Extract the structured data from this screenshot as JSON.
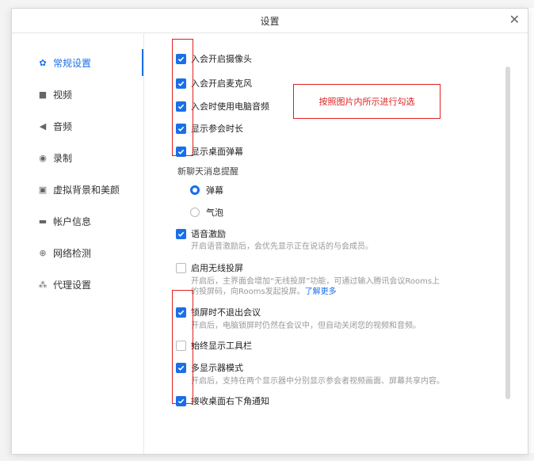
{
  "dialog": {
    "title": "设置"
  },
  "sidebar": {
    "items": [
      {
        "label": "常规设置",
        "icon": "gear-icon",
        "active": true
      },
      {
        "label": "视频",
        "icon": "video-icon"
      },
      {
        "label": "音频",
        "icon": "speaker-icon"
      },
      {
        "label": "录制",
        "icon": "record-icon"
      },
      {
        "label": "虚拟背景和美颜",
        "icon": "portrait-icon"
      },
      {
        "label": "帐户信息",
        "icon": "id-card-icon"
      },
      {
        "label": "网络检测",
        "icon": "globe-icon"
      },
      {
        "label": "代理设置",
        "icon": "network-icon"
      }
    ]
  },
  "options": [
    {
      "label": "入会开启摄像头",
      "checked": true
    },
    {
      "label": "入会开启麦克风",
      "checked": true
    },
    {
      "label": "入会时使用电脑音频",
      "checked": true
    },
    {
      "label": "显示参会时长",
      "checked": true
    },
    {
      "label": "显示桌面弹幕",
      "checked": true
    }
  ],
  "chat_alert": {
    "label": "新聊天消息提醒",
    "options": [
      {
        "label": "弹幕",
        "selected": true
      },
      {
        "label": "气泡",
        "selected": false
      }
    ]
  },
  "voice": {
    "label": "语音激励",
    "checked": true,
    "desc": "开启语音激励后，会优先显示正在说话的与会成员。"
  },
  "wireless": {
    "label": "启用无线投屏",
    "checked": false,
    "desc1": "开启后，主界面会增加“无线投屏”功能，可通过输入腾讯会议Rooms上",
    "desc2": "的投屏码，向Rooms发起投屏。",
    "link": "了解更多"
  },
  "lock": {
    "label": "锁屏时不退出会议",
    "checked": true,
    "desc": "开启后，电脑锁屏时仍然在会议中，但自动关闭您的视频和音频。"
  },
  "toolbar": {
    "label": "始终显示工具栏",
    "checked": false
  },
  "multi": {
    "label": "多显示器模式",
    "checked": true,
    "desc": "开启后，支持在两个显示器中分别显示参会者视频画面、屏幕共享内容。"
  },
  "notify": {
    "label": "接收桌面右下角通知",
    "checked": true
  },
  "annotation": {
    "text": "按照图片内所示进行勾选"
  },
  "accent_color": "#1a6fe8",
  "annotation_color": "#e02020"
}
